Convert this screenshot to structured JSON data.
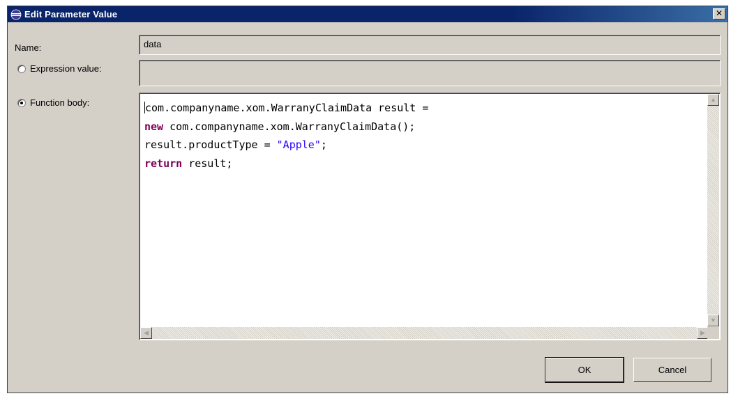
{
  "dialog": {
    "title": "Edit Parameter Value",
    "close_glyph": "✕",
    "icon": "eclipse-icon"
  },
  "name": {
    "label": "Name:",
    "value": "data"
  },
  "expression": {
    "label": "Expression value:",
    "value": "",
    "selected": false
  },
  "function_body": {
    "label": "Function body:",
    "selected": true,
    "lines": [
      [
        {
          "t": "com.companyname.xom.WarranyClaimData result =",
          "k": "plain"
        }
      ],
      [
        {
          "t": "new",
          "k": "kw"
        },
        {
          "t": " com.companyname.xom.WarranyClaimData();",
          "k": "plain"
        }
      ],
      [
        {
          "t": "result.productType = ",
          "k": "plain"
        },
        {
          "t": "\"Apple\"",
          "k": "str"
        },
        {
          "t": ";",
          "k": "plain"
        }
      ],
      [
        {
          "t": "return",
          "k": "kw"
        },
        {
          "t": " result;",
          "k": "plain"
        }
      ]
    ]
  },
  "buttons": {
    "ok": "OK",
    "cancel": "Cancel"
  },
  "colors": {
    "titlebar": "#0a246a",
    "keyword": "#7f0055",
    "string": "#2a00ff",
    "dialog_bg": "#d4d0c8"
  }
}
